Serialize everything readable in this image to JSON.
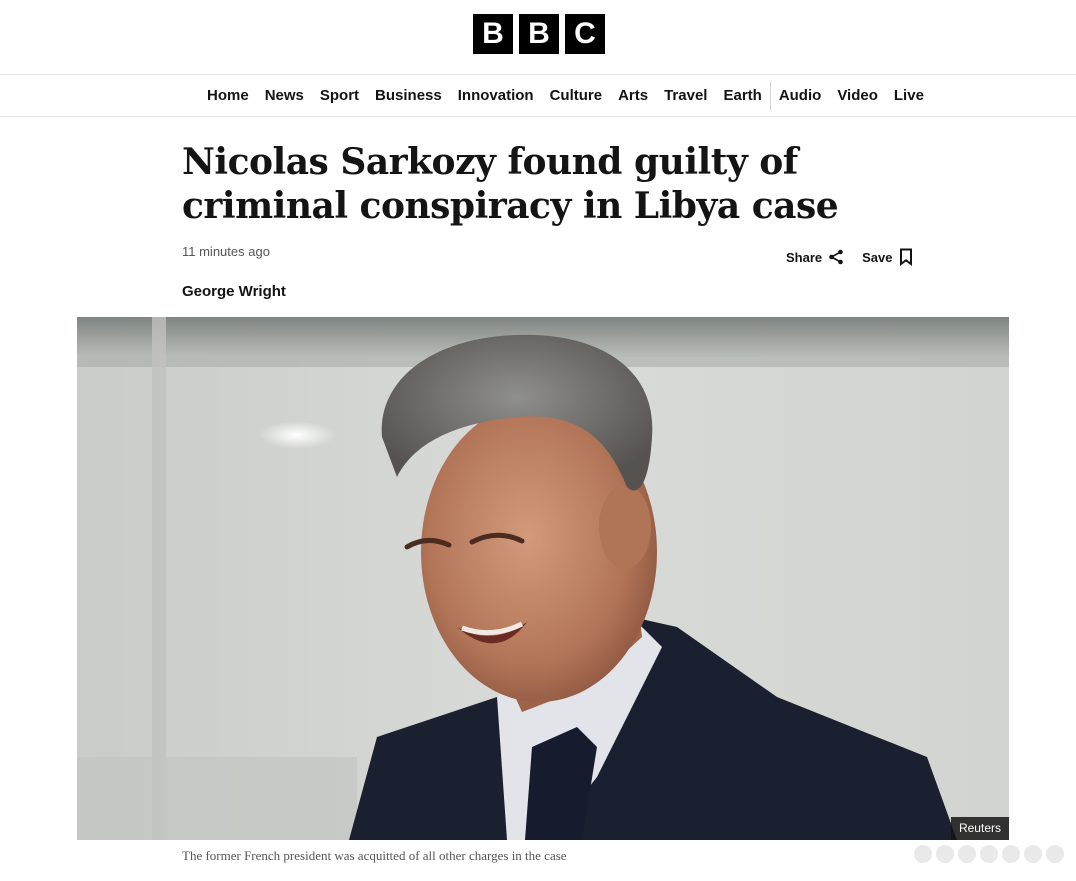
{
  "brand": {
    "letters": [
      "B",
      "B",
      "C"
    ]
  },
  "nav": {
    "primary": [
      "Home",
      "News",
      "Sport",
      "Business",
      "Innovation",
      "Culture",
      "Arts",
      "Travel",
      "Earth"
    ],
    "secondary": [
      "Audio",
      "Video",
      "Live"
    ]
  },
  "article": {
    "headline": "Nicolas Sarkozy found guilty of criminal conspiracy in Libya case",
    "timestamp": "11 minutes ago",
    "byline": "George Wright",
    "share_label": "Share",
    "save_label": "Save",
    "image_credit": "Reuters",
    "caption": "The former French president was acquitted of all other charges in the case"
  },
  "icons": {
    "share": "share-icon",
    "save": "bookmark-icon"
  },
  "colors": {
    "logo_bg": "#000000",
    "text": "#141414",
    "muted": "#545658"
  }
}
